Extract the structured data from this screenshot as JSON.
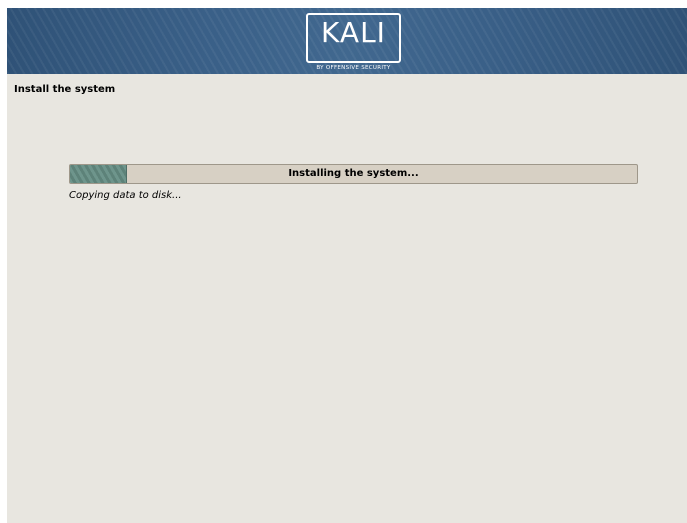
{
  "window": {
    "banner": {
      "logo_text": "KALI",
      "logo_subtitle": "BY OFFENSIVE SECURITY"
    },
    "page_title": "Install the system",
    "progress": {
      "label": "Installing the system...",
      "fraction": 0.1,
      "fill_color": "#6e958c",
      "track_color": "#d7d0c4"
    },
    "status_text": "Copying data to disk..."
  },
  "colors": {
    "banner": "#3a6088",
    "background": "#e8e6e0"
  }
}
